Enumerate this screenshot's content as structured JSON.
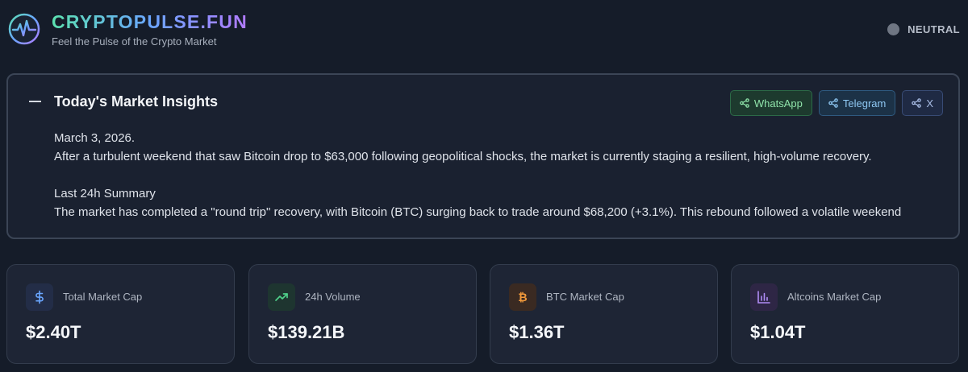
{
  "header": {
    "brand_title": "CRYPTOPULSE.FUN",
    "tagline": "Feel the Pulse of the Crypto Market",
    "sentiment_label": "NEUTRAL",
    "logo_icon": "pulse-logo-icon"
  },
  "insights": {
    "title": "Today's Market Insights",
    "share_buttons": [
      {
        "label": "WhatsApp",
        "icon": "share-icon"
      },
      {
        "label": "Telegram",
        "icon": "share-icon"
      },
      {
        "label": "X",
        "icon": "share-icon"
      }
    ],
    "date": "March 3, 2026.",
    "intro": "After a turbulent weekend that saw Bitcoin drop to $63,000 following geopolitical shocks, the market is currently staging a resilient, high-volume recovery.",
    "summary_heading": "Last 24h Summary",
    "summary_text": "The market has completed a \"round trip\" recovery, with Bitcoin (BTC) surging back to trade around $68,200 (+3.1%). This rebound followed a volatile weekend"
  },
  "cards": [
    {
      "label": "Total Market Cap",
      "value": "$2.40T",
      "icon": "dollar-icon"
    },
    {
      "label": "24h Volume",
      "value": "$139.21B",
      "icon": "trending-up-icon"
    },
    {
      "label": "BTC Market Cap",
      "value": "$1.36T",
      "icon": "bitcoin-icon"
    },
    {
      "label": "Altcoins Market Cap",
      "value": "$1.04T",
      "icon": "bar-chart-icon"
    }
  ],
  "colors": {
    "background": "#151c29",
    "whatsapp": "#8fe3aa",
    "telegram": "#8fc8f3",
    "x": "#a9bde6",
    "sentiment_neutral": "#6f7683"
  }
}
